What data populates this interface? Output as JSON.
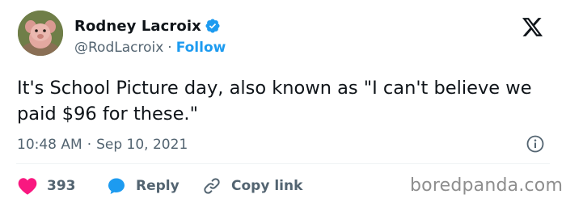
{
  "author": {
    "display_name": "Rodney Lacroix",
    "handle": "@RodLacroix",
    "separator": "·",
    "follow_label": "Follow",
    "verified": true
  },
  "tweet": {
    "text": "It's School Picture day, also known as \"I can't believe we paid $96 for these.\"",
    "time": "10:48 AM",
    "separator": "·",
    "date": "Sep 10, 2021"
  },
  "actions": {
    "likes": "393",
    "reply_label": "Reply",
    "copy_link_label": "Copy link"
  },
  "watermark": "boredpanda.com",
  "icons": {
    "verified": "verified-badge-icon",
    "platform": "x-logo-icon",
    "info": "info-icon",
    "like": "heart-icon",
    "reply": "reply-bubble-icon",
    "copy": "link-icon"
  },
  "colors": {
    "text": "#0f1419",
    "secondary": "#536471",
    "accent": "#1d9bf0",
    "like": "#f91880",
    "divider": "#eff3f4"
  }
}
